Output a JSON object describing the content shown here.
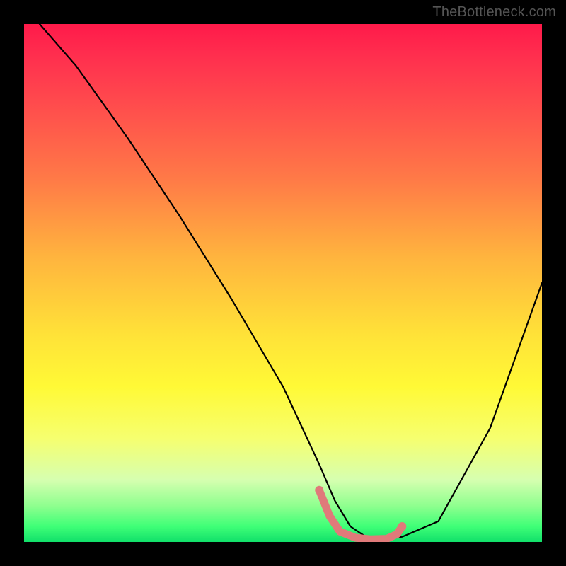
{
  "watermark": "TheBottleneck.com",
  "chart_data": {
    "type": "line",
    "title": "",
    "xlabel": "",
    "ylabel": "",
    "xlim": [
      0,
      100
    ],
    "ylim": [
      0,
      100
    ],
    "grid": false,
    "legend": false,
    "series": [
      {
        "name": "curve",
        "color": "#000000",
        "x": [
          3,
          10,
          20,
          30,
          40,
          50,
          57,
          60,
          63,
          66,
          70,
          73,
          80,
          90,
          100
        ],
        "y": [
          100,
          92,
          78,
          63,
          47,
          30,
          15,
          8,
          3,
          1,
          0.5,
          1,
          4,
          22,
          50
        ]
      },
      {
        "name": "highlight",
        "color": "#e07a7a",
        "x": [
          57,
          59,
          61,
          64,
          67,
          70,
          72,
          73
        ],
        "y": [
          10,
          5,
          2,
          0.8,
          0.5,
          0.6,
          1.5,
          3
        ]
      }
    ],
    "background_gradient": {
      "top": "#ff1a4a",
      "mid": "#ffe238",
      "bottom": "#11e06a"
    }
  }
}
